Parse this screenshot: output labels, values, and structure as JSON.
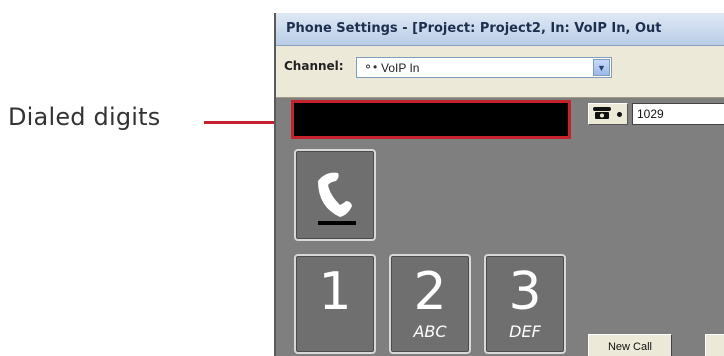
{
  "callout": {
    "label": "Dialed digits",
    "color": "#c4222c"
  },
  "window": {
    "title": "Phone Settings - [Project: Project2, In: VoIP In, Out"
  },
  "channel": {
    "label": "Channel:",
    "icon": "connection-dots-icon",
    "value": "VoIP In"
  },
  "dial": {
    "display_value": "",
    "extension": "1029",
    "hook_icon": "handset-icon"
  },
  "keypad": [
    {
      "digit": "1",
      "letters": ""
    },
    {
      "digit": "2",
      "letters": "ABC"
    },
    {
      "digit": "3",
      "letters": "DEF"
    }
  ],
  "buttons": {
    "new_call": "New Call"
  }
}
